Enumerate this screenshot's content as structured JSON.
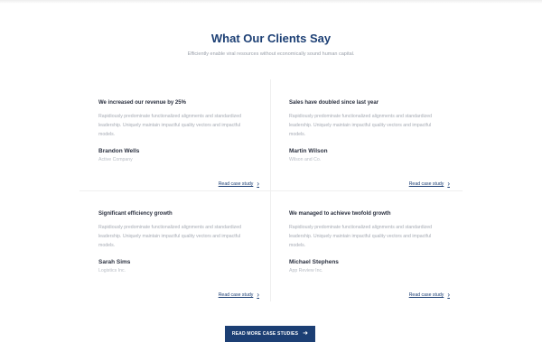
{
  "section": {
    "title": "What Our Clients Say",
    "subtitle": "Efficiently enable viral resources without economically sound human capital."
  },
  "testimonials": [
    {
      "headline": "We increased our revenue by 25%",
      "body": "Rapidiously predominate functionalized alignments and standardized leadership. Uniquely maintain impactful quality vectors and impactful models.",
      "name": "Brandon Wells",
      "company": "Active Company",
      "link": "Read case study"
    },
    {
      "headline": "Sales have doubled since last year",
      "body": "Rapidiously predominate functionalized alignments and standardized leadership. Uniquely maintain impactful quality vectors and impactful models.",
      "name": "Martin Wilson",
      "company": "Wilson and Co.",
      "link": "Read case study"
    },
    {
      "headline": "Significant efficiency growth",
      "body": "Rapidiously predominate functionalized alignments and standardized leadership. Uniquely maintain impactful quality vectors and impactful models.",
      "name": "Sarah Sims",
      "company": "Logistics Inc.",
      "link": "Read case study"
    },
    {
      "headline": "We managed to achieve twofold growth",
      "body": "Rapidiously predominate functionalized alignments and standardized leadership. Uniquely maintain impactful quality vectors and impactful models.",
      "name": "Michael Stephens",
      "company": "App Review Inc.",
      "link": "Read case study"
    }
  ],
  "cta": {
    "label": "READ MORE CASE STUDIES",
    "icon": "arrow-right-icon"
  },
  "icons": {
    "link_chevron": "chevron-right-icon"
  },
  "colors": {
    "brand": "#1c3f74",
    "muted_text": "#a6abb4",
    "heading_text": "#2b3140"
  }
}
